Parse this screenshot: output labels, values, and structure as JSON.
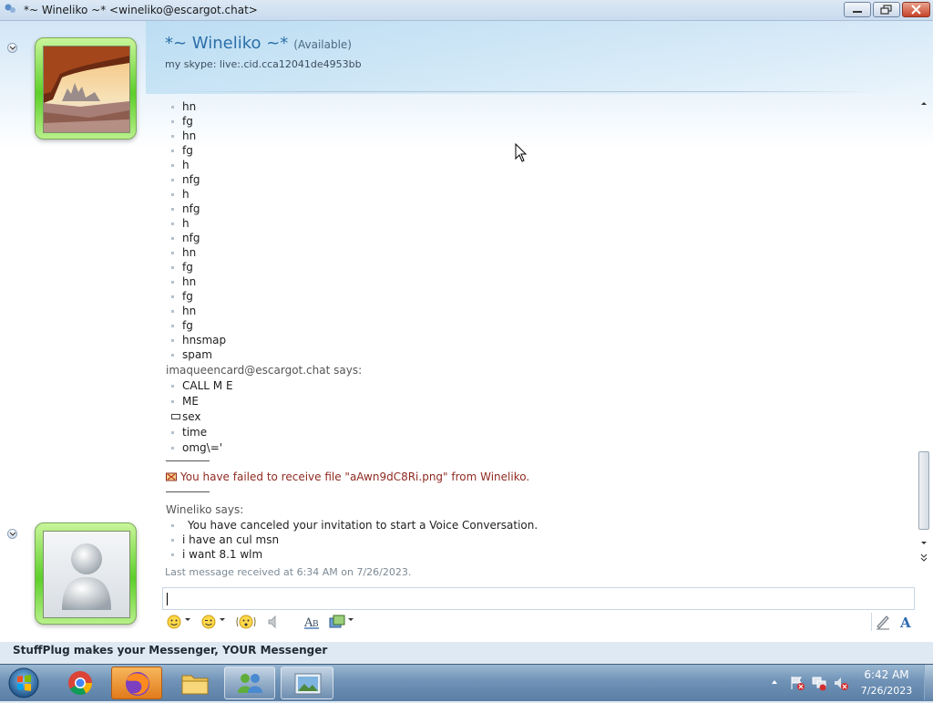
{
  "window": {
    "title": "*~ Wineliko ~* <wineliko@escargot.chat>"
  },
  "contact": {
    "name": "*~ Wineliko ~*",
    "status": "(Available)",
    "personal_message": "my skype: live:.cid.cca12041de4953bb"
  },
  "conversation": {
    "block1_lines": [
      "hn",
      "fg",
      "hn",
      "fg",
      "h",
      "nfg",
      "h",
      "nfg",
      "h",
      "nfg",
      "hn",
      "fg",
      "hn",
      "fg",
      "hn",
      "fg",
      "hnsmap",
      "spam"
    ],
    "speaker2": "imaqueencard@escargot.chat says:",
    "block2_lines": [
      "CALL M E",
      "ME",
      "sex",
      "time",
      "omg\\='"
    ],
    "file_failed": "You have failed to receive file \"aAwn9dC8Ri.png\" from Wineliko.",
    "speaker3": "Wineliko says:",
    "block3_lines": [
      "You have canceled your invitation to start a Voice Conversation.",
      "i have an cul msn",
      "i want 8.1 wlm"
    ],
    "last_message": "Last message received at 6:34 AM on 7/26/2023."
  },
  "input": {
    "value": ""
  },
  "toolbar": {
    "icons": [
      "emoticon-icon",
      "wink-icon",
      "nudge-icon",
      "voice-clip-icon",
      "font-icon",
      "background-icon",
      "handwriting-icon",
      "text-style-icon"
    ]
  },
  "footer": {
    "text": "StuffPlug makes your Messenger, YOUR Messenger"
  },
  "taskbar": {
    "apps": [
      "start-orb-icon",
      "chrome-icon",
      "firefox-icon",
      "file-explorer-icon",
      "messenger-icon",
      "image-viewer-icon"
    ],
    "time": "6:42 AM",
    "date": "7/26/2023"
  },
  "colors": {
    "accent": "#2b6fa8",
    "error_text": "#8f2b22",
    "avatar_frame": "#5dcf2a"
  }
}
